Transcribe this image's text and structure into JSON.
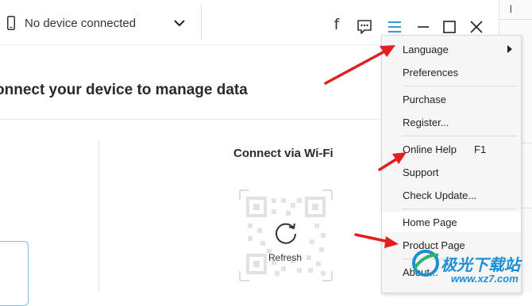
{
  "titlebar": {
    "device_status": "No device connected",
    "icons": [
      "phone-icon",
      "chevron-down-icon",
      "facebook-icon",
      "feedback-icon",
      "menu-icon",
      "minimize-icon",
      "maximize-icon",
      "close-icon"
    ]
  },
  "main": {
    "heading": "onnect your device to manage data",
    "wifi_title": "Connect via Wi-Fi",
    "refresh_label": "Refresh"
  },
  "menu": {
    "items": [
      {
        "label": "Language",
        "shortcut": ""
      },
      {
        "label": "Preferences",
        "shortcut": ""
      },
      {
        "label": "Purchase",
        "shortcut": ""
      },
      {
        "label": "Register...",
        "shortcut": ""
      },
      {
        "label": "Online Help",
        "shortcut": "F1"
      },
      {
        "label": "Support",
        "shortcut": ""
      },
      {
        "label": "Check Update...",
        "shortcut": ""
      },
      {
        "label": "Home Page",
        "shortcut": ""
      },
      {
        "label": "Product Page",
        "shortcut": ""
      },
      {
        "label": "About...",
        "shortcut": ""
      }
    ]
  },
  "right_window": {
    "letter": "l"
  },
  "watermark": {
    "name": "极光下载站",
    "url": "www.xz7.com"
  },
  "colors": {
    "accent": "#1b8fd6",
    "arrow": "#e02020",
    "menu_bg": "#f6f6f6",
    "phone_outline": "#7fc3dc"
  }
}
